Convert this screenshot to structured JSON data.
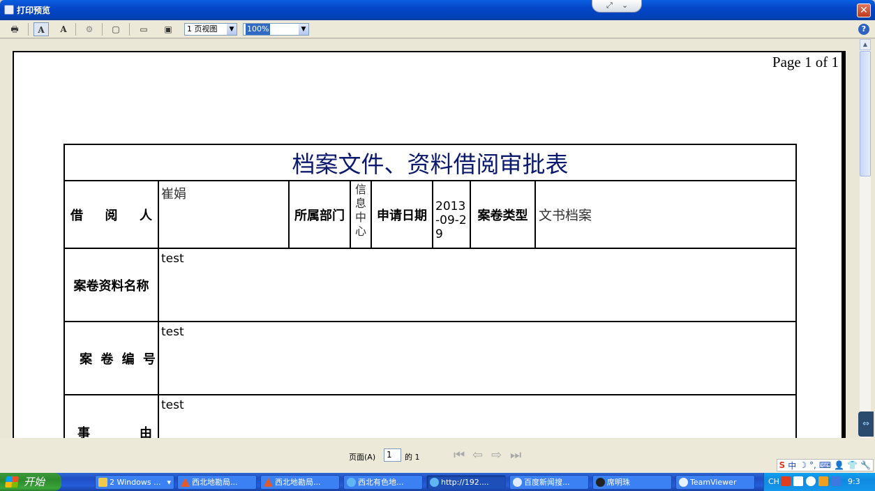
{
  "window": {
    "title": "打印预览"
  },
  "toolbar": {
    "view_select": "1 页视图",
    "zoom_select": "100%",
    "help": "?"
  },
  "page": {
    "page_label": "Page 1 of 1"
  },
  "form": {
    "title": "档案文件、资料借阅审批表",
    "borrower_label": "借　阅　人",
    "borrower_value": "崔娟",
    "dept_label": "所属部门",
    "dept_value": "信息中心",
    "date_label": "申请日期",
    "date_value": "2013-09-29",
    "type_label": "案卷类型",
    "type_value": "文书档案",
    "name_label": "案卷资料名称",
    "name_value": "test",
    "number_label": "案 卷 编 号",
    "number_value": "test",
    "reason_label": "事　　由",
    "reason_value": "test"
  },
  "nav": {
    "page_label": "页面(A)",
    "page_value": "1",
    "of_label": "的 1"
  },
  "taskbar": {
    "start": "开始",
    "tasks": [
      "2 Windows ...",
      "西北地勘局...",
      "西北地勘局...",
      "西北有色地...",
      "http://192....",
      "百度新闻搜...",
      "席明珠",
      "TeamViewer"
    ],
    "lang": "CH",
    "clock": "9:3"
  }
}
